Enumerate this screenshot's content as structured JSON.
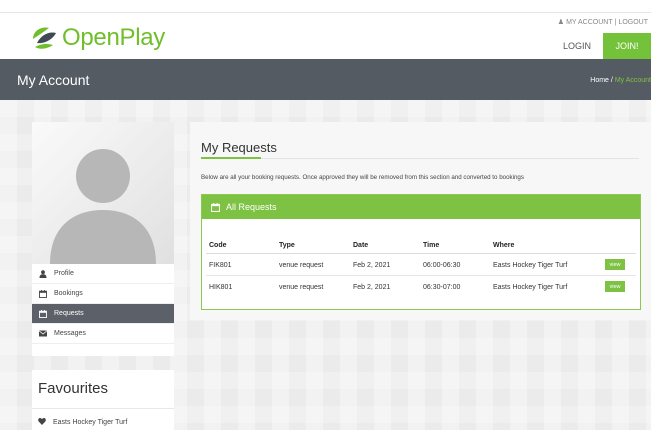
{
  "header": {
    "logo_text": "OpenPlay",
    "my_account": "MY ACCOUNT",
    "logout": "LOGOUT",
    "login": "LOGIN",
    "join": "JOIN!",
    "brand_color": "#74c23a"
  },
  "banner": {
    "title": "My Account",
    "crumb_home": "Home",
    "crumb_sep": "/",
    "crumb_current": "My Account"
  },
  "sidebar": {
    "items": [
      {
        "label": "Profile",
        "icon": "user-icon"
      },
      {
        "label": "Bookings",
        "icon": "calendar-icon"
      },
      {
        "label": "Requests",
        "icon": "calendar-icon",
        "active": true
      },
      {
        "label": "Messages",
        "icon": "envelope-icon"
      }
    ]
  },
  "favourites": {
    "title": "Favourites",
    "items": [
      {
        "label": "Easts Hockey Tiger Turf",
        "icon": "heart-icon"
      }
    ]
  },
  "requests": {
    "title": "My Requests",
    "description": "Below are all your booking requests. Once approved they will be removed from this section and converted to bookings",
    "card_title": "All Requests",
    "columns": [
      "Code",
      "Type",
      "Date",
      "Time",
      "Where"
    ],
    "rows": [
      {
        "code": "FIK801",
        "type": "venue request",
        "date": "Feb 2, 2021",
        "time": "06:00-06:30",
        "where": "Easts Hockey Tiger Turf",
        "action": "view"
      },
      {
        "code": "HIK801",
        "type": "venue request",
        "date": "Feb 2, 2021",
        "time": "06:30-07:00",
        "where": "Easts Hockey Tiger Turf",
        "action": "view"
      }
    ]
  }
}
